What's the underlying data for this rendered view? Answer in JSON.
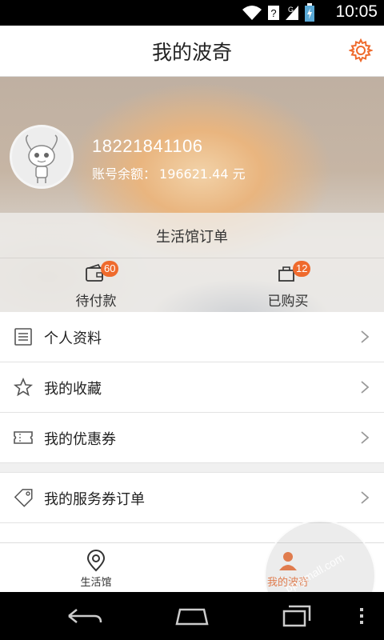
{
  "status_bar": {
    "time": "10:05"
  },
  "header": {
    "title": "我的波奇",
    "settings_icon": "gear-icon"
  },
  "profile": {
    "phone": "18221841106",
    "balance_label": "账号余额：",
    "balance_value": "196621.44 元"
  },
  "orders": {
    "title": "生活馆订单",
    "items": [
      {
        "label": "待付款",
        "badge": "60",
        "icon": "wallet-icon"
      },
      {
        "label": "已购买",
        "badge": "12",
        "icon": "bag-icon"
      }
    ]
  },
  "menu": {
    "group1": [
      {
        "label": "个人资料",
        "icon": "profile-card-icon"
      },
      {
        "label": "我的收藏",
        "icon": "star-icon"
      },
      {
        "label": "我的优惠券",
        "icon": "coupon-icon"
      }
    ],
    "group2": [
      {
        "label": "我的服务券订单",
        "icon": "tag-icon"
      }
    ]
  },
  "tabbar": {
    "tabs": [
      {
        "label": "生活馆",
        "icon": "location-pin-icon",
        "active": false
      },
      {
        "label": "我的波奇",
        "icon": "user-icon",
        "active": true
      }
    ]
  },
  "colors": {
    "accent": "#ef6a2c",
    "divider": "#e3e3e3"
  },
  "watermark": {
    "text": "pp.ymall.com"
  }
}
